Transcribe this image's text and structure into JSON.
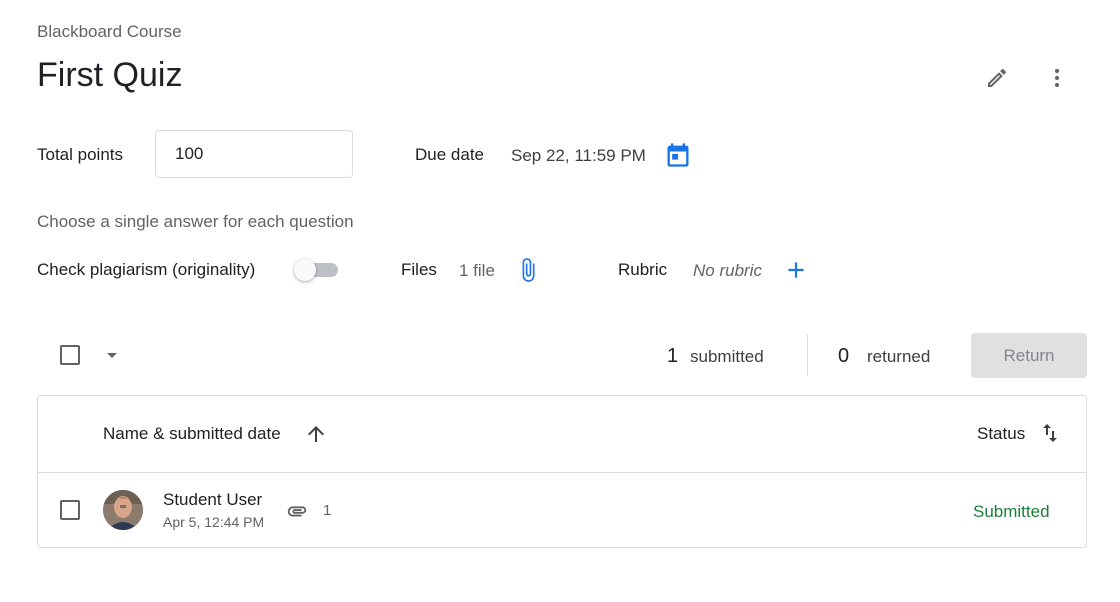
{
  "header": {
    "course_name": "Blackboard Course",
    "title": "First Quiz",
    "edit_icon": "pencil-icon",
    "more_icon": "more-vert-icon"
  },
  "assignment": {
    "total_points_label": "Total points",
    "total_points_value": "100",
    "due_label": "Due date",
    "due_value": "Sep 22, 11:59 PM",
    "calendar_icon": "calendar-icon",
    "instructions": "Choose a single answer for each question",
    "plagiarism_label": "Check plagiarism (originality)",
    "plagiarism_enabled": false,
    "files_label": "Files",
    "files_value": "1 file",
    "rubric_label": "Rubric",
    "rubric_value": "No rubric"
  },
  "toolbar": {
    "submitted_count": "1",
    "submitted_label": "submitted",
    "returned_count": "0",
    "returned_label": "returned",
    "return_button": "Return"
  },
  "table": {
    "columns": {
      "name": "Name & submitted date",
      "status": "Status"
    },
    "rows": [
      {
        "name": "Student User",
        "date": "Apr 5, 12:44 PM",
        "attachments": "1",
        "status": "Submitted"
      }
    ]
  },
  "colors": {
    "accent": "#1a73e8",
    "status_submitted": "#188038",
    "button_disabled": "#e0e0e0"
  }
}
